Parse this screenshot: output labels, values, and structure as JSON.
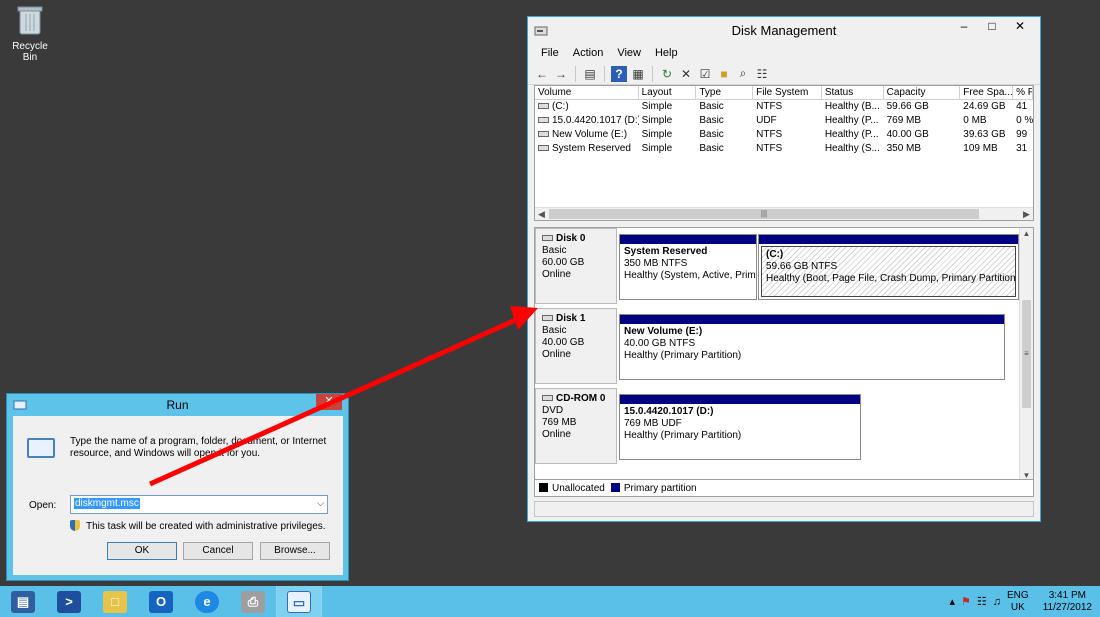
{
  "desktop": {
    "recycle_bin_label": "Recycle Bin"
  },
  "disk_mgmt": {
    "title": "Disk Management",
    "menu": [
      "File",
      "Action",
      "View",
      "Help"
    ],
    "columns": [
      "Volume",
      "Layout",
      "Type",
      "File System",
      "Status",
      "Capacity",
      "Free Spa...",
      "% F"
    ],
    "volumes": [
      [
        "(C:)",
        "Simple",
        "Basic",
        "NTFS",
        "Healthy (B...",
        "59.66 GB",
        "24.69 GB",
        "41"
      ],
      [
        "15.0.4420.1017 (D:)",
        "Simple",
        "Basic",
        "UDF",
        "Healthy (P...",
        "769 MB",
        "0 MB",
        "0 %"
      ],
      [
        "New Volume (E:)",
        "Simple",
        "Basic",
        "NTFS",
        "Healthy (P...",
        "40.00 GB",
        "39.63 GB",
        "99"
      ],
      [
        "System Reserved",
        "Simple",
        "Basic",
        "NTFS",
        "Healthy (S...",
        "350 MB",
        "109 MB",
        "31"
      ]
    ],
    "disks": [
      {
        "name": "Disk 0",
        "type": "Basic",
        "size": "60.00 GB",
        "state": "Online",
        "partitions": [
          {
            "name": "System Reserved",
            "size": "350 MB NTFS",
            "status": "Healthy (System, Active, Prim"
          },
          {
            "name": "(C:)",
            "size": "59.66 GB NTFS",
            "status": "Healthy (Boot, Page File, Crash Dump, Primary Partition)"
          }
        ]
      },
      {
        "name": "Disk 1",
        "type": "Basic",
        "size": "40.00 GB",
        "state": "Online",
        "partitions": [
          {
            "name": "New Volume  (E:)",
            "size": "40.00 GB NTFS",
            "status": "Healthy (Primary Partition)"
          }
        ]
      },
      {
        "name": "CD-ROM 0",
        "type": "DVD",
        "size": "769 MB",
        "state": "Online",
        "partitions": [
          {
            "name": "15.0.4420.1017  (D:)",
            "size": "769 MB UDF",
            "status": "Healthy (Primary Partition)"
          }
        ]
      }
    ],
    "legend": {
      "unallocated": "Unallocated",
      "primary": "Primary partition"
    },
    "colors": {
      "unallocated": "#000000",
      "primary": "#000080"
    }
  },
  "run": {
    "title": "Run",
    "description": "Type the name of a program, folder, document, or Internet resource, and Windows will open it for you.",
    "open_label": "Open:",
    "open_value": "diskmgmt.msc",
    "admin_note": "This task will be created with administrative privileges.",
    "ok_label": "OK",
    "cancel_label": "Cancel",
    "browse_label": "Browse..."
  },
  "taskbar": {
    "apps": [
      "server-manager",
      "powershell",
      "file-explorer",
      "outlook",
      "internet-explorer",
      "printer",
      "run"
    ],
    "lang_top": "ENG",
    "lang_bottom": "UK",
    "time": "3:41 PM",
    "date": "11/27/2012"
  },
  "annotation": {
    "arrow_color": "#ff0000"
  }
}
